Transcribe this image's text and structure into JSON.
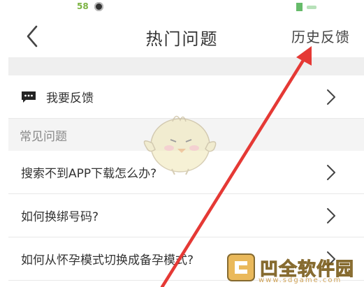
{
  "status_bar": {
    "left_badge": "58"
  },
  "header": {
    "title": "热门问题",
    "right_link": "历史反馈"
  },
  "feedback": {
    "label": "我要反馈"
  },
  "faq": {
    "section_title": "常见问题",
    "items": [
      {
        "label": "搜索不到APP下载怎么办?"
      },
      {
        "label": "如何换绑号码?"
      },
      {
        "label": "如何从怀孕模式切换成备孕模式?"
      }
    ]
  },
  "watermark": {
    "text": "凹全软件园",
    "url": "www.sdgame.com"
  },
  "colors": {
    "arrow": "#e53935",
    "accent_green": "#7cb342",
    "text_dark": "#333333",
    "section_bg": "#f4f4f4"
  }
}
